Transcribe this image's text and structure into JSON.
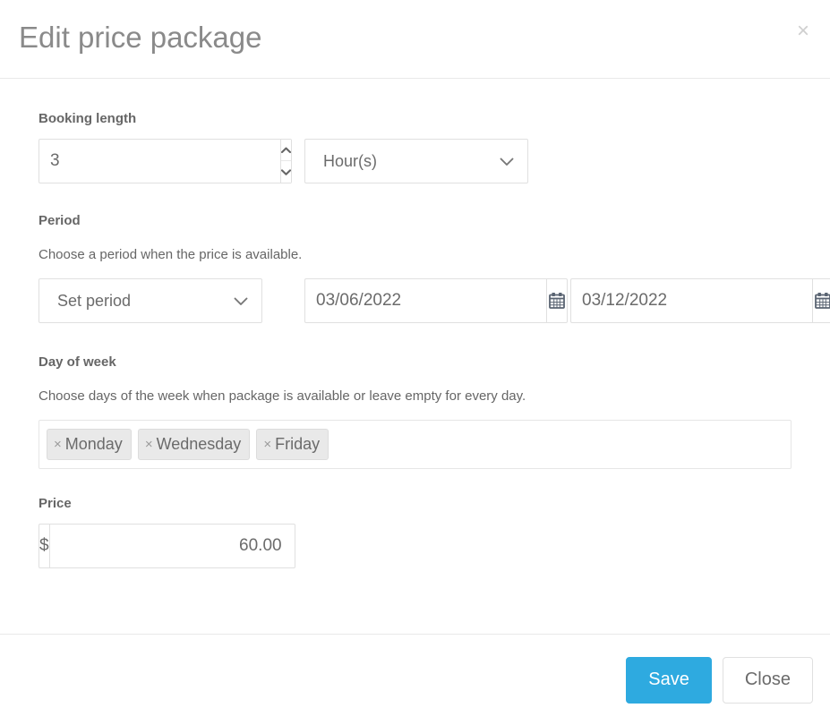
{
  "header": {
    "title": "Edit price package",
    "close_label": "×"
  },
  "booking_length": {
    "label": "Booking length",
    "value": "3",
    "placeholder": "",
    "unit_selected": "Hour(s)"
  },
  "period": {
    "label": "Period",
    "help": "Choose a period when the price is available.",
    "mode_selected": "Set period",
    "start_date": "03/06/2022",
    "end_date": "03/12/2022",
    "date_placeholder": ""
  },
  "day_of_week": {
    "label": "Day of week",
    "help": "Choose days of the week when package is available or leave empty for every day.",
    "remove_glyph": "×",
    "tags": [
      {
        "label": "Monday"
      },
      {
        "label": "Wednesday"
      },
      {
        "label": "Friday"
      }
    ]
  },
  "price": {
    "label": "Price",
    "currency_symbol": "$",
    "value": "60.00",
    "placeholder": ""
  },
  "footer": {
    "save_label": "Save",
    "close_label": "Close"
  },
  "colors": {
    "primary": "#2eaae0",
    "text": "#6b6b6b",
    "title": "#8a8a8a",
    "border": "#e0e0e0",
    "tag_bg": "#e9e9e9"
  }
}
